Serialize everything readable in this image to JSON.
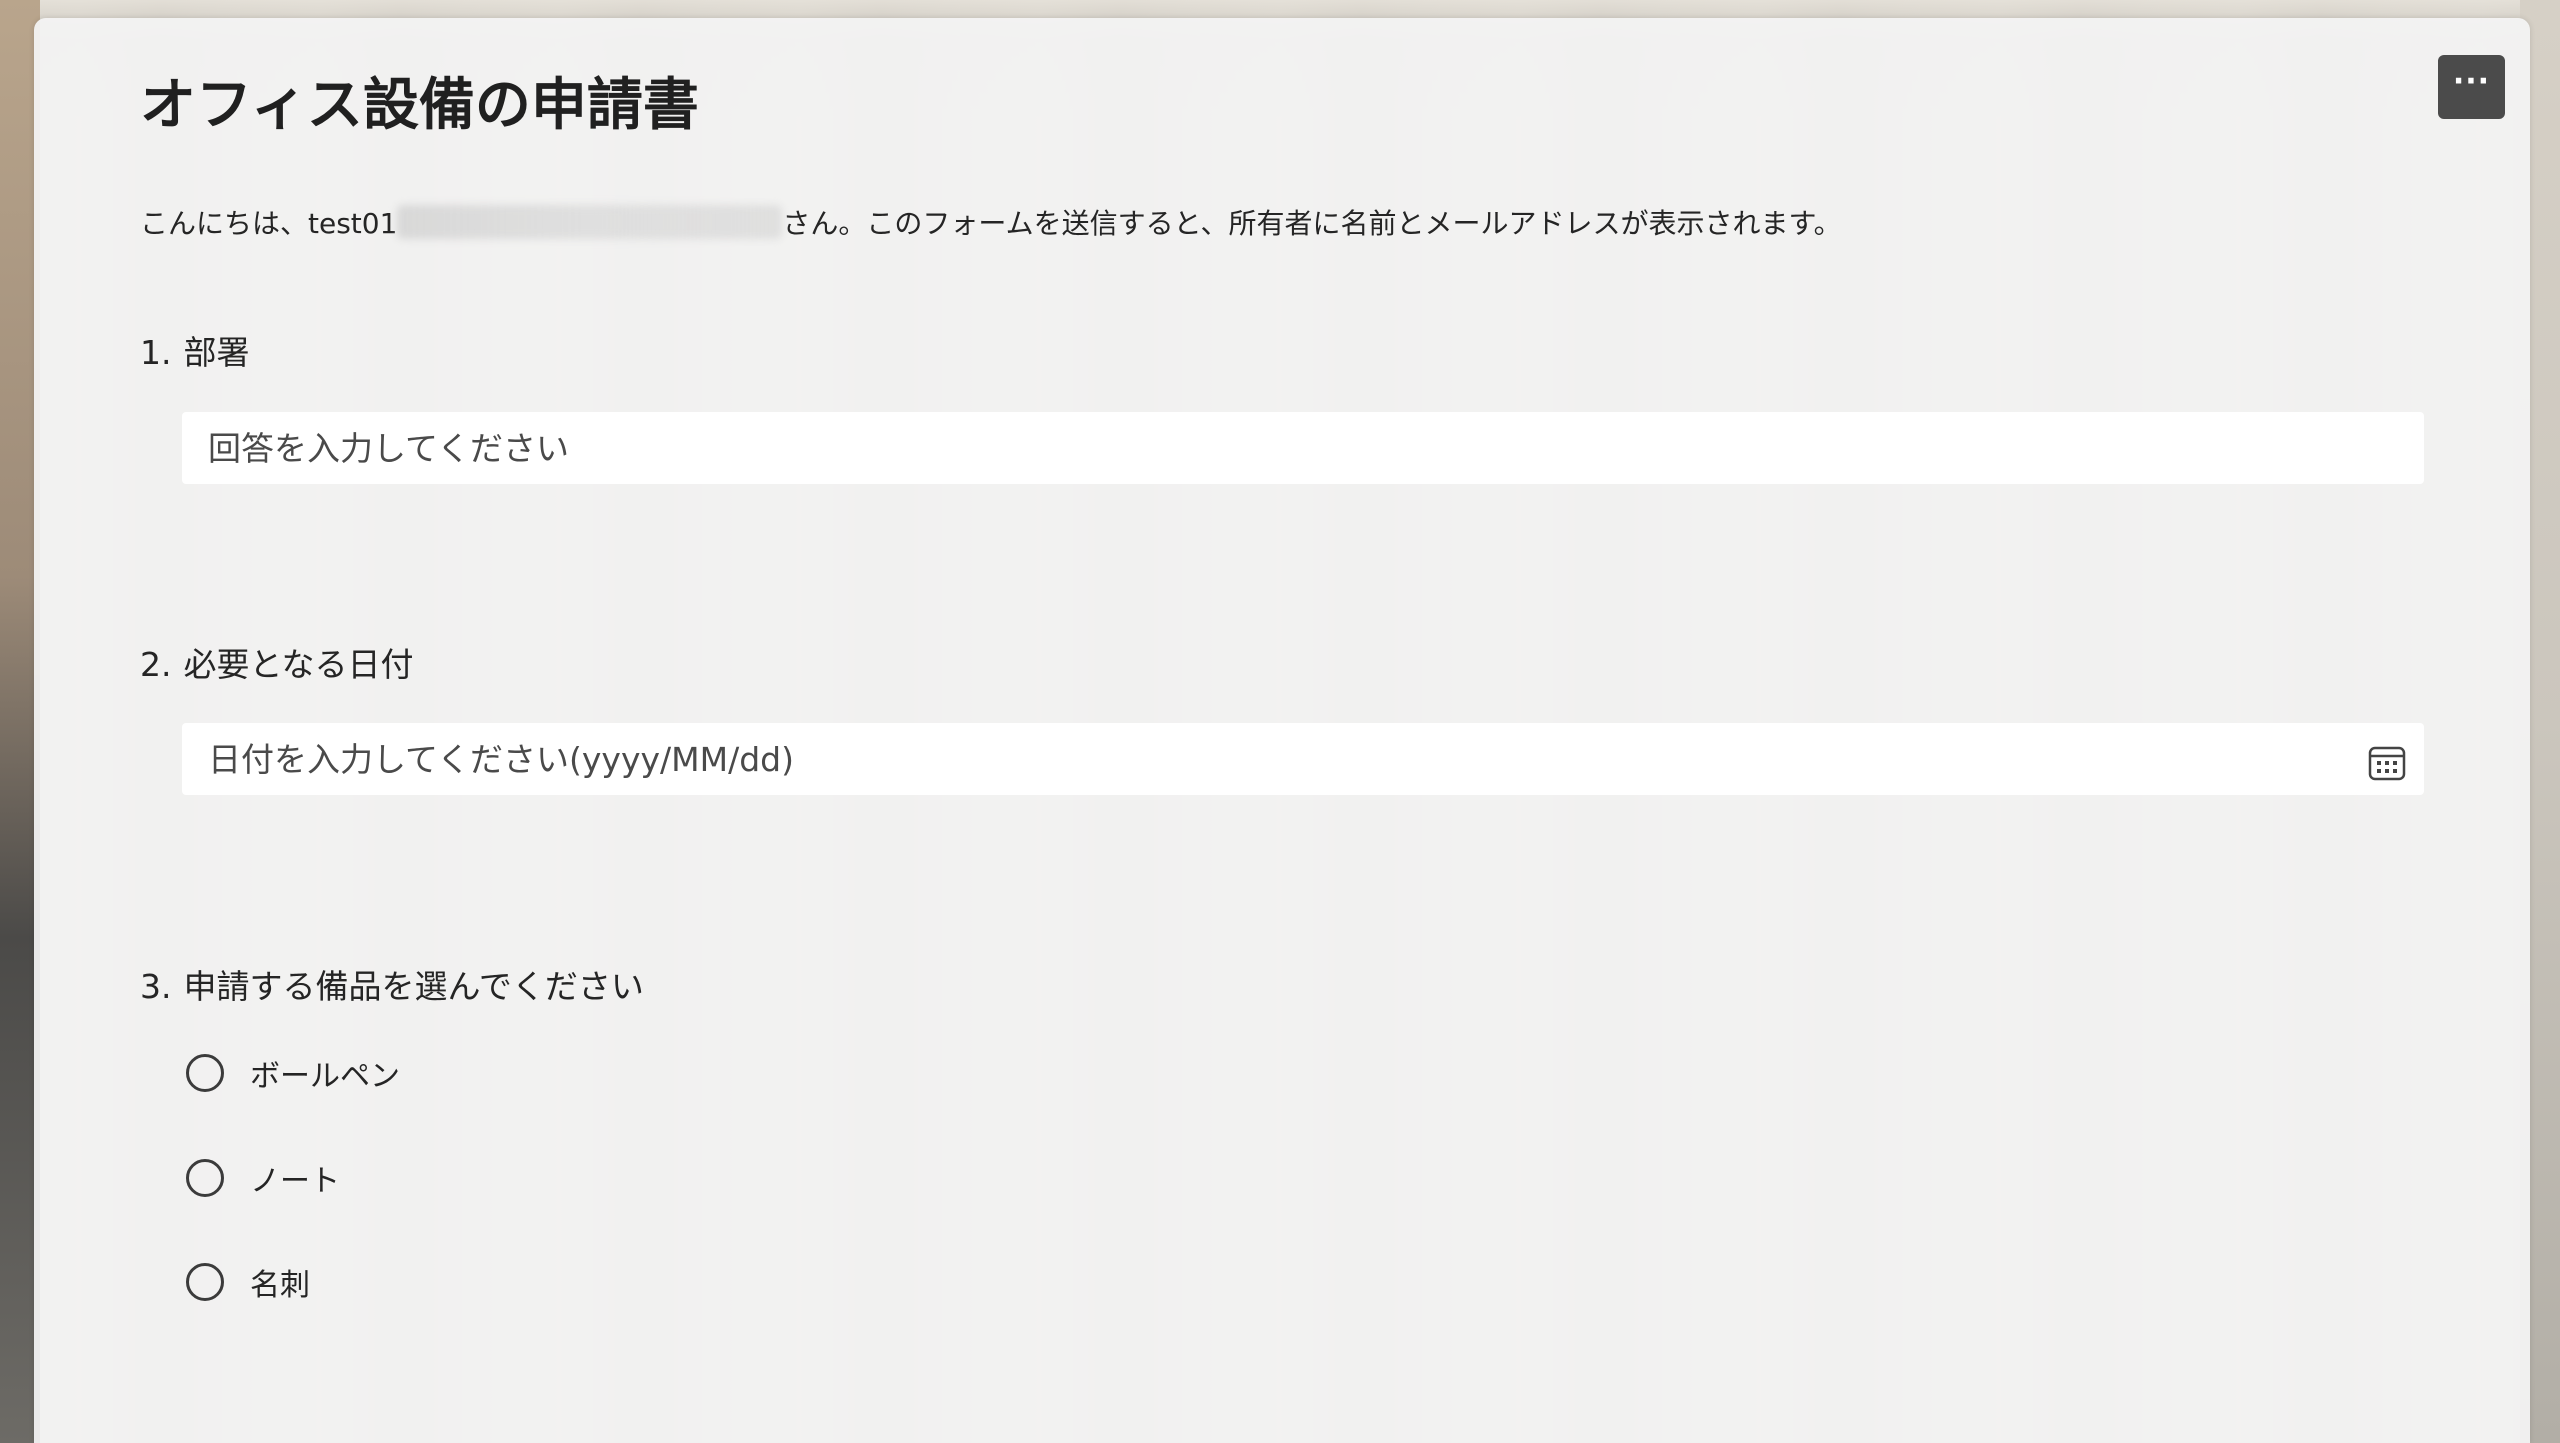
{
  "form": {
    "title": "オフィス設備の申請書",
    "greeting_prefix": "こんにちは、test01",
    "greeting_suffix": "さん。このフォームを送信すると、所有者に名前とメールアドレスが表示されます。",
    "more_label": "···"
  },
  "questions": [
    {
      "number": "1.",
      "label": "部署",
      "placeholder": "回答を入力してください"
    },
    {
      "number": "2.",
      "label": "必要となる日付",
      "placeholder": "日付を入力してください(yyyy/MM/dd)",
      "icon": "calendar-icon"
    },
    {
      "number": "3.",
      "label": "申請する備品を選んでください",
      "options": [
        "ボールペン",
        "ノート",
        "名刺"
      ]
    }
  ],
  "colors": {
    "more_button_bg": "#4b4b4b",
    "card_bg": "#f4f4f4",
    "text": "#252525"
  }
}
